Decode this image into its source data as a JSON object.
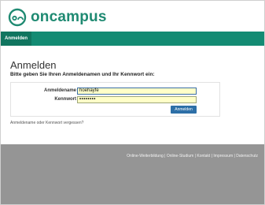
{
  "brand": {
    "name": "oncampus",
    "color": "#1f8a72"
  },
  "nav": {
    "tabs": [
      {
        "label": "Anmelden"
      }
    ],
    "color": "#138b73"
  },
  "page": {
    "title": "Anmelden",
    "subtitle": "Bitte geben Sie Ihren Anmeldenamen und Ihr Kennwort ein:"
  },
  "form": {
    "username_label": "Anmeldename",
    "username_value": "hoehayfe",
    "password_label": "Kennwort",
    "password_value": "••••••••",
    "submit_label": "Anmelden"
  },
  "links": {
    "forgot": "Anmeldename oder Kennwort vergessen?"
  },
  "footer": {
    "links_text": "Online-Weiterbildung | Online-Studium | Kontakt | Impressum | Datenschutz"
  }
}
